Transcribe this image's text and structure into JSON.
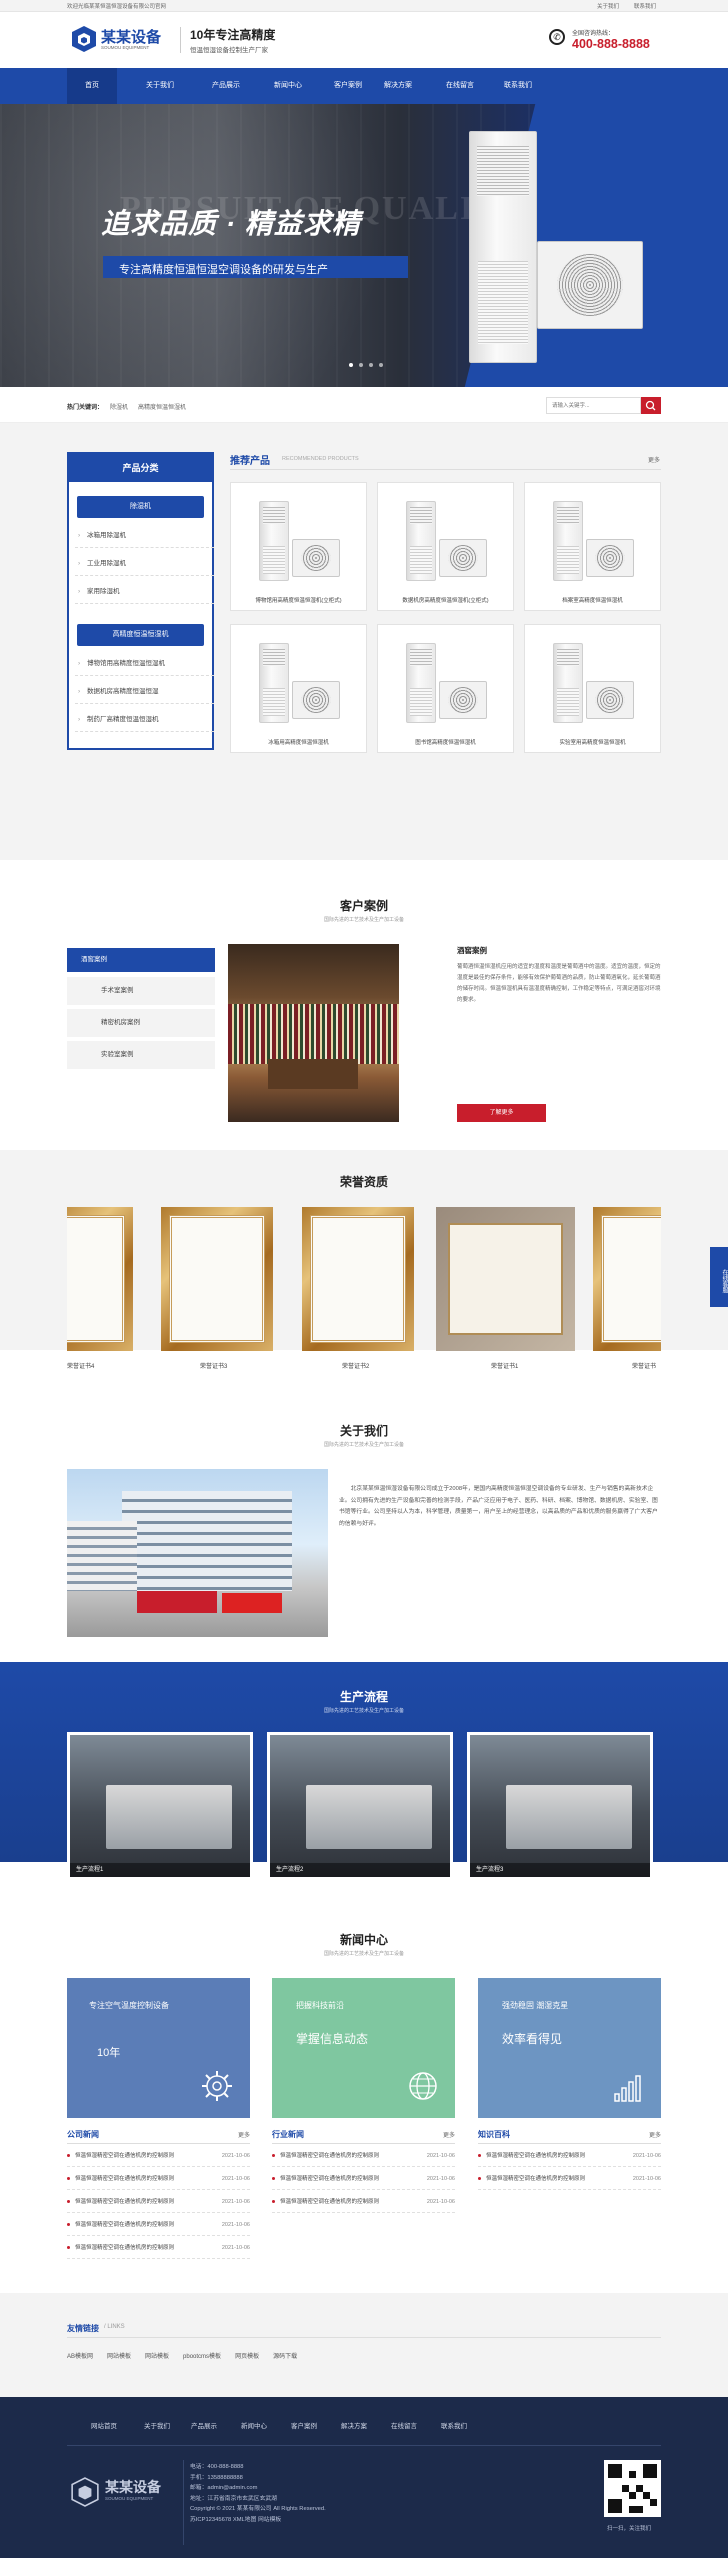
{
  "topbar": {
    "welcome": "欢迎光临某某恒温恒湿设备有限公司官网",
    "links": [
      "关于我们",
      "联系我们"
    ]
  },
  "header": {
    "logo_name": "某某设备",
    "logo_en": "SOUMOU EQUIPMENT",
    "slogan_title": "10年专注高精度",
    "slogan_sub": "恒温恒湿设备控制生产厂家",
    "hotline_label": "全国咨询热线：",
    "hotline": "400-888-8888"
  },
  "nav": {
    "items": [
      "首页",
      "关于我们",
      "产品展示",
      "新闻中心",
      "客户案例",
      "解决方案",
      "在线留言",
      "联系我们"
    ]
  },
  "banner": {
    "bg_text": "PURSUIT OF QUALITY",
    "title": "追求品质 · 精益求精",
    "subtitle": "专注高精度恒温恒湿空调设备的研发与生产",
    "dots": 4
  },
  "search": {
    "label": "热门关键词：",
    "keywords": [
      "除湿机",
      "高精度恒温恒湿机"
    ],
    "placeholder": "请输入关键字..."
  },
  "products": {
    "side_title": "产品分类",
    "groups": [
      {
        "title": "除湿机",
        "items": [
          "冰箱用除湿机",
          "工业用除湿机",
          "家用除湿机"
        ]
      },
      {
        "title": "高精度恒温恒湿机",
        "items": [
          "博物馆用高精度恒温恒湿机",
          "数据机房高精度恒温恒湿",
          "制药厂高精度恒温恒湿机"
        ]
      }
    ],
    "title": "推荐产品",
    "title_en": "RECOMMENDED PRODUCTS",
    "more": "更多",
    "cards": [
      "博物馆用高精度恒温恒湿机(立柜式)",
      "数据机房高精度恒温恒湿机(立柜式)",
      "档案室高精度恒温恒湿机",
      "冰箱用高精度恒温恒湿机",
      "图书馆高精度恒温恒湿机",
      "实验室用高精度恒温恒湿机"
    ]
  },
  "cases": {
    "title": "客户案例",
    "subtitle": "国际先进的工艺技术及生产加工设备",
    "tabs": [
      "酒窖案例",
      "手术室案例",
      "精密机房案例",
      "实验室案例"
    ],
    "active_tab": 0,
    "item_title": "酒窖案例",
    "item_text": "葡萄酒恒温恒湿机应用的适宜的湿度和温度是葡萄酒中的温度。适宜的温度，恒定的湿度是最佳的保存条件，能够有效保护葡萄酒的品质，防止葡萄酒氧化，延长葡萄酒的储存时间。恒温恒湿机具有温湿度精确控制，工作稳定等特点，可满足酒窖对环境的要求。",
    "button": "了解更多"
  },
  "honors": {
    "title": "荣誉资质",
    "certs": [
      "荣誉证书4",
      "荣誉证书3",
      "荣誉证书2",
      "荣誉证书1",
      "荣誉证书"
    ]
  },
  "about": {
    "title": "关于我们",
    "subtitle": "国际先进的工艺技术及生产加工设备",
    "text": "北京某某恒温恒湿设备有限公司成立于2008年，是国内高精度恒温恒湿空调设备的专业研发、生产与销售的高新技术企业。公司拥有先进的生产设备和完善的检测手段，产品广泛应用于电子、医药、科研、档案、博物馆、数据机房、实验室、图书馆等行业。公司坚持以人为本，科学管理，质量第一，用户至上的经营理念，以高品质的产品和优质的服务赢得了广大客户的信赖与好评。"
  },
  "process": {
    "title": "生产流程",
    "subtitle": "国际先进的工艺技术及生产加工设备",
    "items": [
      "生产流程1",
      "生产流程2",
      "生产流程3"
    ]
  },
  "news": {
    "title": "新闻中心",
    "subtitle": "国际先进的工艺技术及生产加工设备",
    "cards": [
      {
        "title": "专注空气温度控制设备",
        "big": "10年",
        "color": "#5b7db7"
      },
      {
        "title": "把握科技前沿",
        "big": "掌握信息动态",
        "color": "#7fc7a0"
      },
      {
        "title": "强劲稳固 潮湿克星",
        "big": "效率看得见",
        "color": "#6d95c2"
      }
    ],
    "columns": [
      {
        "title": "公司新闻",
        "more": "更多",
        "rows": [
          [
            "恒温恒湿精密空调在通信机房的控制原则",
            "2021-10-06"
          ],
          [
            "恒温恒湿精密空调在通信机房的控制原则",
            "2021-10-06"
          ],
          [
            "恒温恒湿精密空调在通信机房的控制原则",
            "2021-10-06"
          ],
          [
            "恒温恒湿精密空调在通信机房的控制原则",
            "2021-10-06"
          ],
          [
            "恒温恒湿精密空调在通信机房的控制原则",
            "2021-10-06"
          ]
        ]
      },
      {
        "title": "行业新闻",
        "more": "更多",
        "rows": [
          [
            "恒温恒湿精密空调在通信机房的控制原则",
            "2021-10-06"
          ],
          [
            "恒温恒湿精密空调在通信机房的控制原则",
            "2021-10-06"
          ],
          [
            "恒温恒湿精密空调在通信机房的控制原则",
            "2021-10-06"
          ]
        ]
      },
      {
        "title": "知识百科",
        "more": "更多",
        "rows": [
          [
            "恒温恒湿精密空调在通信机房的控制原则",
            "2021-10-06"
          ],
          [
            "恒温恒湿精密空调在通信机房的控制原则",
            "2021-10-06"
          ]
        ]
      }
    ]
  },
  "links": {
    "title": "友情链接",
    "title_en": "/ LINKS",
    "items": [
      "AB模板网",
      "网站模板",
      "网站模板",
      "pbootcms模板",
      "网页模板",
      "源码下载"
    ]
  },
  "footer": {
    "nav": [
      "网站首页",
      "关于我们",
      "产品展示",
      "新闻中心",
      "客户案例",
      "解决方案",
      "在线留言",
      "联系我们"
    ],
    "logo_name": "某某设备",
    "logo_en": "SOUMOU EQUIPMENT",
    "phone": "电话：400-888-8888",
    "mobile": "手机：13588888888",
    "email": "邮箱：admin@admin.com",
    "address": "地址：江苏省南京市玄武区玄武湖",
    "copyright": "Copyright © 2021 某某有限公司 All Rights Reserved.",
    "icp": "苏ICP12345678 XML地图 网站模板",
    "qr_caption": "扫一扫，关注我们"
  },
  "float": {
    "label": "在线客服"
  },
  "colors": {
    "primary": "#1e4aa8",
    "red": "#c81e2c",
    "dark": "#1c2a4a"
  }
}
